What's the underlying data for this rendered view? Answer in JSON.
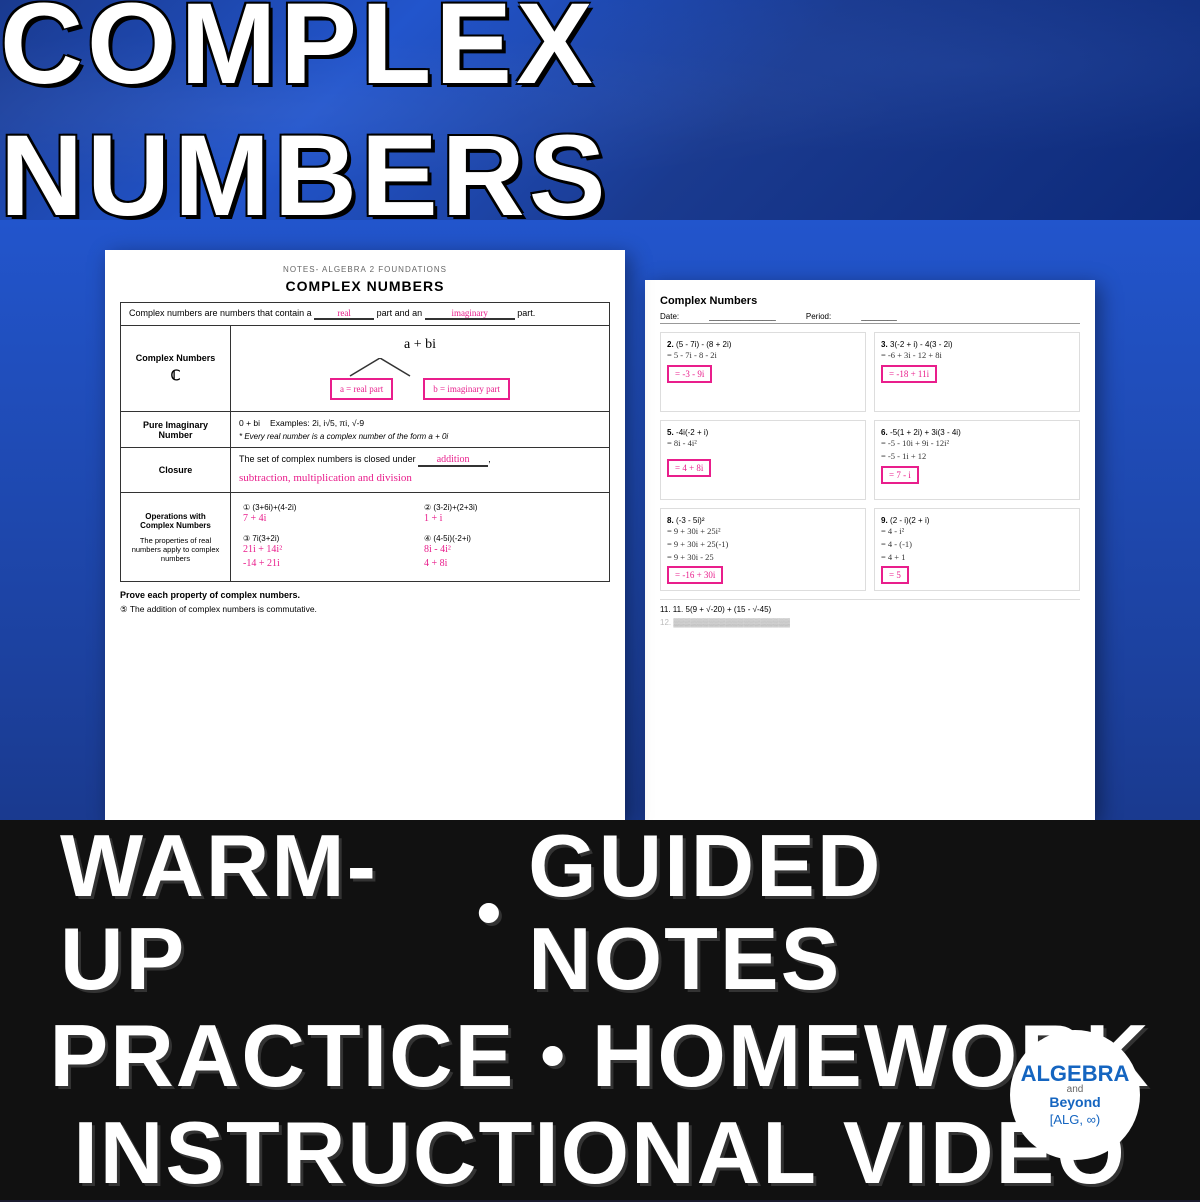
{
  "header": {
    "title": "COMPLEX NUMBERS",
    "bg_color": "#1a3a8f"
  },
  "left_doc": {
    "subtitle": "NOTES- ALGEBRA 2 FOUNDATIONS",
    "title": "COMPLEX NUMBERS",
    "definition": "Complex numbers are numbers that contain a",
    "real_blank": "real",
    "imaginary_blank": "imaginary",
    "definition_end": "part and an",
    "definition_end2": "part.",
    "abi_form": "a + bi",
    "real_part_label": "a = real part",
    "imaginary_part_label": "b = imaginary part",
    "complex_numbers_label": "Complex Numbers",
    "complex_symbol": "ℂ",
    "pure_imaginary_label": "Pure Imaginary Number",
    "pure_imaginary_form": "0 + bi",
    "pure_imaginary_examples": "Examples: 2i, i√5, πi, √-9",
    "pure_imaginary_note": "* Every real number is a complex number of the form  a + 0i",
    "closure_label": "Closure",
    "closure_text": "The set of complex numbers is closed under",
    "closure_words": [
      "addition",
      "subtraction",
      "multiplication",
      "and",
      "division"
    ],
    "ops_label": "Operations with Complex Numbers",
    "ops_subtext": "The properties of real numbers apply to complex numbers",
    "problem1": "(3+6i)+(4-2i)",
    "answer1": "7 + 4i",
    "problem2": "(3-2i)+(2+3i)",
    "answer2": "1 + i",
    "problem3": "7i(3+2i)",
    "work3a": "21i + 14i²",
    "work3b": "-14 + 21i",
    "problem4": "(4-5i)(-2+i)",
    "work4a": "8i - 4i²",
    "work4b": "4 + 8i",
    "prove_text": "Prove each property of complex numbers.",
    "prove_item": "⑤ The addition of complex numbers is commutative."
  },
  "right_doc": {
    "title": "Complex Numbers",
    "date_label": "Date:",
    "period_label": "Period:",
    "problems": [
      {
        "num": "2.",
        "problem": "(5 - 7i) - (8 + 2i)",
        "work": "= 5 - 7i - 8 - 2i",
        "answer": "= -3 - 9i",
        "answer_color": "pink"
      },
      {
        "num": "3.",
        "problem": "3(-2 + i) - 4(3 - 2i)",
        "work": "= -6 + 3i - 12 + 8i",
        "answer": "= -18 + 11i",
        "answer_color": "pink"
      },
      {
        "num": "5.",
        "problem": "-4i(-2 + i)",
        "work1": "= 8i - 4i²",
        "answer": "= 4 + 8i",
        "answer_color": "pink"
      },
      {
        "num": "6.",
        "problem": "-5(1 + 2i) + 3i(3 - 4i)",
        "work1": "= -5 - 10i + 9i - 12i²",
        "work2": "= -5 - 1i + 12",
        "answer": "= 7 - i",
        "answer_color": "pink"
      },
      {
        "num": "8.",
        "problem": "(-3 - 5i)²",
        "work1": "= 9 + 30i + 25i²",
        "work2": "= 9 + 30i + 25(-1)",
        "work3": "= 9 + 30i - 25",
        "answer": "= -16 + 30i",
        "answer_color": "pink"
      },
      {
        "num": "9.",
        "problem": "(2 - i)(2 + i)",
        "work1": "= 4 - i²",
        "work2": "= 4 - (-1)",
        "work3": "= 4 + 1",
        "answer": "= 5",
        "answer_color": "pink"
      }
    ],
    "problem11": "11. 5(9 + √-20) + (15 - √-45)"
  },
  "bottom": {
    "line1_part1": "WARM-UP",
    "bullet1": "•",
    "line1_part2": "GUIDED NOTES",
    "line2_part1": "PRACTICE",
    "bullet2": "•",
    "line2_part2": "HOMEWORK",
    "line3": "INSTRUCTIONAL VIDEO",
    "logo_algebra": "ALGEBRA",
    "logo_and": "and",
    "logo_beyond": "Beyond",
    "logo_bracket": "[ALG, ∞)"
  }
}
